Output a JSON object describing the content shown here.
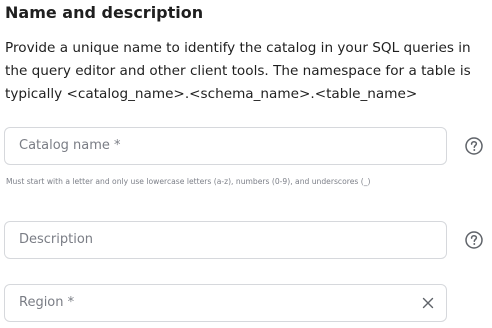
{
  "section": {
    "title": "Name and description",
    "description_lines": [
      "Provide a unique name to identify the catalog in your SQL queries in",
      "the query editor and other client tools. The namespace for a table is",
      "typically <catalog_name>.<schema_name>.<table_name>"
    ]
  },
  "fields": {
    "catalog_name": {
      "label": "Catalog name *",
      "hint": "Must start with a letter and only use lowercase letters (a-z), numbers (0-9), and underscores (_)"
    },
    "description": {
      "label": "Description"
    },
    "region": {
      "label": "Region *"
    }
  },
  "icons": {
    "help": "question-circle-icon",
    "clear": "close-icon"
  }
}
